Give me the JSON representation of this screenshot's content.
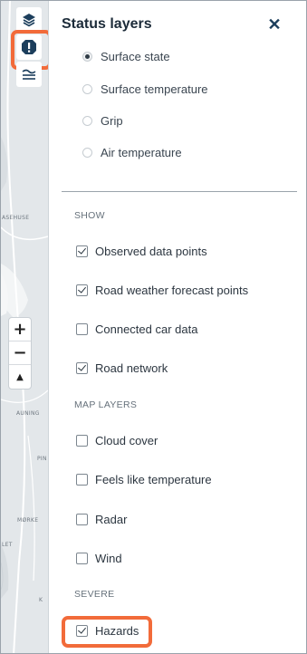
{
  "map": {
    "labels": [
      "ASEHUSE",
      "AUNING",
      "PIN",
      "MØRKE",
      "LET",
      "K"
    ]
  },
  "panel": {
    "title": "Status layers",
    "close_symbol": "✕",
    "radio_options": [
      {
        "label": "Surface state",
        "checked": true
      },
      {
        "label": "Surface temperature",
        "checked": false
      },
      {
        "label": "Grip",
        "checked": false
      },
      {
        "label": "Air temperature",
        "checked": false
      }
    ],
    "show_section": {
      "heading": "SHOW",
      "items": [
        {
          "label": "Observed data points",
          "checked": true
        },
        {
          "label": "Road weather forecast points",
          "checked": true
        },
        {
          "label": "Connected car data",
          "checked": false
        },
        {
          "label": "Road network",
          "checked": true
        }
      ]
    },
    "map_layers_section": {
      "heading": "MAP LAYERS",
      "items": [
        {
          "label": "Cloud cover",
          "checked": false
        },
        {
          "label": "Feels like temperature",
          "checked": false
        },
        {
          "label": "Radar",
          "checked": false
        },
        {
          "label": "Wind",
          "checked": false
        }
      ]
    },
    "severe_section": {
      "heading": "SEVERE",
      "items": [
        {
          "label": "Hazards",
          "checked": true
        }
      ]
    }
  },
  "colors": {
    "highlight": "#f26b3a",
    "title": "#1c2b39",
    "map_bg": "#e3e7ea"
  },
  "icons": [
    "layers-icon",
    "warning-hexagon-icon",
    "waves-icon",
    "zoom-in-icon",
    "zoom-out-icon",
    "compass-icon",
    "close-icon"
  ],
  "zoom": {
    "plus": "+",
    "minus": "−",
    "north": "▲"
  }
}
